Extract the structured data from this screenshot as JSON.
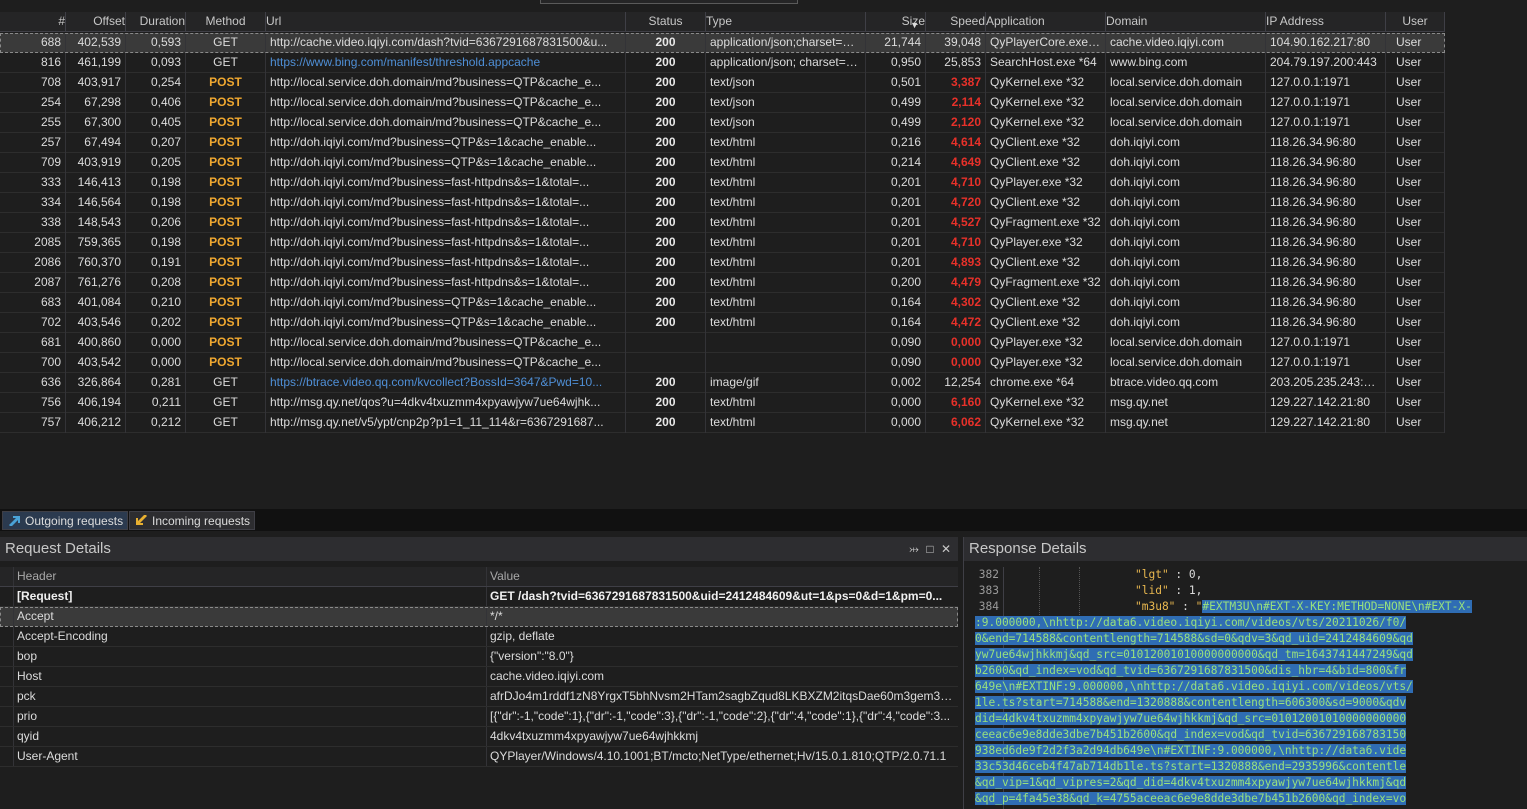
{
  "columns": [
    "#",
    "Offset",
    "Duration",
    "Method",
    "Url",
    "Status",
    "Type",
    "Size",
    "Speed",
    "Application",
    "Domain",
    "IP Address",
    "User"
  ],
  "sessions": [
    {
      "num": "688",
      "offset": "402,539",
      "duration": "0,593",
      "method": "GET",
      "url": "http://cache.video.iqiyi.com/dash?tvid=6367291687831500&u...",
      "status": "200",
      "type": "application/json;charset=ut...",
      "size": "21,744",
      "speed": "39,048",
      "app": "QyPlayerCore.exe *32",
      "domain": "cache.video.iqiyi.com",
      "ip": "104.90.162.217:80",
      "user": "User"
    },
    {
      "num": "816",
      "offset": "461,199",
      "duration": "0,093",
      "method": "GET",
      "url": "https://www.bing.com/manifest/threshold.appcache",
      "status": "200",
      "type": "application/json; charset=u...",
      "size": "0,950",
      "speed": "25,853",
      "app": "SearchHost.exe *64",
      "domain": "www.bing.com",
      "ip": "204.79.197.200:443",
      "user": "User"
    },
    {
      "num": "708",
      "offset": "403,917",
      "duration": "0,254",
      "method": "POST",
      "url": "http://local.service.doh.domain/md?business=QTP&cache_e...",
      "status": "200",
      "type": "text/json",
      "size": "0,501",
      "speed": "3,387",
      "app": "QyKernel.exe *32",
      "domain": "local.service.doh.domain",
      "ip": "127.0.0.1:1971",
      "user": "User"
    },
    {
      "num": "254",
      "offset": "67,298",
      "duration": "0,406",
      "method": "POST",
      "url": "http://local.service.doh.domain/md?business=QTP&cache_e...",
      "status": "200",
      "type": "text/json",
      "size": "0,499",
      "speed": "2,114",
      "app": "QyKernel.exe *32",
      "domain": "local.service.doh.domain",
      "ip": "127.0.0.1:1971",
      "user": "User"
    },
    {
      "num": "255",
      "offset": "67,300",
      "duration": "0,405",
      "method": "POST",
      "url": "http://local.service.doh.domain/md?business=QTP&cache_e...",
      "status": "200",
      "type": "text/json",
      "size": "0,499",
      "speed": "2,120",
      "app": "QyKernel.exe *32",
      "domain": "local.service.doh.domain",
      "ip": "127.0.0.1:1971",
      "user": "User"
    },
    {
      "num": "257",
      "offset": "67,494",
      "duration": "0,207",
      "method": "POST",
      "url": "http://doh.iqiyi.com/md?business=QTP&s=1&cache_enable...",
      "status": "200",
      "type": "text/html",
      "size": "0,216",
      "speed": "4,614",
      "app": "QyClient.exe *32",
      "domain": "doh.iqiyi.com",
      "ip": "118.26.34.96:80",
      "user": "User"
    },
    {
      "num": "709",
      "offset": "403,919",
      "duration": "0,205",
      "method": "POST",
      "url": "http://doh.iqiyi.com/md?business=QTP&s=1&cache_enable...",
      "status": "200",
      "type": "text/html",
      "size": "0,214",
      "speed": "4,649",
      "app": "QyClient.exe *32",
      "domain": "doh.iqiyi.com",
      "ip": "118.26.34.96:80",
      "user": "User"
    },
    {
      "num": "333",
      "offset": "146,413",
      "duration": "0,198",
      "method": "POST",
      "url": "http://doh.iqiyi.com/md?business=fast-httpdns&s=1&total=...",
      "status": "200",
      "type": "text/html",
      "size": "0,201",
      "speed": "4,710",
      "app": "QyPlayer.exe *32",
      "domain": "doh.iqiyi.com",
      "ip": "118.26.34.96:80",
      "user": "User"
    },
    {
      "num": "334",
      "offset": "146,564",
      "duration": "0,198",
      "method": "POST",
      "url": "http://doh.iqiyi.com/md?business=fast-httpdns&s=1&total=...",
      "status": "200",
      "type": "text/html",
      "size": "0,201",
      "speed": "4,720",
      "app": "QyClient.exe *32",
      "domain": "doh.iqiyi.com",
      "ip": "118.26.34.96:80",
      "user": "User"
    },
    {
      "num": "338",
      "offset": "148,543",
      "duration": "0,206",
      "method": "POST",
      "url": "http://doh.iqiyi.com/md?business=fast-httpdns&s=1&total=...",
      "status": "200",
      "type": "text/html",
      "size": "0,201",
      "speed": "4,527",
      "app": "QyFragment.exe *32",
      "domain": "doh.iqiyi.com",
      "ip": "118.26.34.96:80",
      "user": "User"
    },
    {
      "num": "2085",
      "offset": "759,365",
      "duration": "0,198",
      "method": "POST",
      "url": "http://doh.iqiyi.com/md?business=fast-httpdns&s=1&total=...",
      "status": "200",
      "type": "text/html",
      "size": "0,201",
      "speed": "4,710",
      "app": "QyPlayer.exe *32",
      "domain": "doh.iqiyi.com",
      "ip": "118.26.34.96:80",
      "user": "User"
    },
    {
      "num": "2086",
      "offset": "760,370",
      "duration": "0,191",
      "method": "POST",
      "url": "http://doh.iqiyi.com/md?business=fast-httpdns&s=1&total=...",
      "status": "200",
      "type": "text/html",
      "size": "0,201",
      "speed": "4,893",
      "app": "QyClient.exe *32",
      "domain": "doh.iqiyi.com",
      "ip": "118.26.34.96:80",
      "user": "User"
    },
    {
      "num": "2087",
      "offset": "761,276",
      "duration": "0,208",
      "method": "POST",
      "url": "http://doh.iqiyi.com/md?business=fast-httpdns&s=1&total=...",
      "status": "200",
      "type": "text/html",
      "size": "0,200",
      "speed": "4,479",
      "app": "QyFragment.exe *32",
      "domain": "doh.iqiyi.com",
      "ip": "118.26.34.96:80",
      "user": "User"
    },
    {
      "num": "683",
      "offset": "401,084",
      "duration": "0,210",
      "method": "POST",
      "url": "http://doh.iqiyi.com/md?business=QTP&s=1&cache_enable...",
      "status": "200",
      "type": "text/html",
      "size": "0,164",
      "speed": "4,302",
      "app": "QyClient.exe *32",
      "domain": "doh.iqiyi.com",
      "ip": "118.26.34.96:80",
      "user": "User"
    },
    {
      "num": "702",
      "offset": "403,546",
      "duration": "0,202",
      "method": "POST",
      "url": "http://doh.iqiyi.com/md?business=QTP&s=1&cache_enable...",
      "status": "200",
      "type": "text/html",
      "size": "0,164",
      "speed": "4,472",
      "app": "QyClient.exe *32",
      "domain": "doh.iqiyi.com",
      "ip": "118.26.34.96:80",
      "user": "User"
    },
    {
      "num": "681",
      "offset": "400,860",
      "duration": "0,000",
      "method": "POST",
      "url": "http://local.service.doh.domain/md?business=QTP&cache_e...",
      "status": "",
      "type": "",
      "size": "0,090",
      "speed": "0,000",
      "app": "QyPlayer.exe *32",
      "domain": "local.service.doh.domain",
      "ip": "127.0.0.1:1971",
      "user": "User"
    },
    {
      "num": "700",
      "offset": "403,542",
      "duration": "0,000",
      "method": "POST",
      "url": "http://local.service.doh.domain/md?business=QTP&cache_e...",
      "status": "",
      "type": "",
      "size": "0,090",
      "speed": "0,000",
      "app": "QyPlayer.exe *32",
      "domain": "local.service.doh.domain",
      "ip": "127.0.0.1:1971",
      "user": "User"
    },
    {
      "num": "636",
      "offset": "326,864",
      "duration": "0,281",
      "method": "GET",
      "url": "https://btrace.video.qq.com/kvcollect?BossId=3647&Pwd=10...",
      "status": "200",
      "type": "image/gif",
      "size": "0,002",
      "speed": "12,254",
      "app": "chrome.exe *64",
      "domain": "btrace.video.qq.com",
      "ip": "203.205.235.243:443",
      "user": "User"
    },
    {
      "num": "756",
      "offset": "406,194",
      "duration": "0,211",
      "method": "GET",
      "url": "http://msg.qy.net/qos?u=4dkv4txuzmm4xpyawjyw7ue64wjhk...",
      "status": "200",
      "type": "text/html",
      "size": "0,000",
      "speed": "6,160",
      "app": "QyKernel.exe *32",
      "domain": "msg.qy.net",
      "ip": "129.227.142.21:80",
      "user": "User"
    },
    {
      "num": "757",
      "offset": "406,212",
      "duration": "0,212",
      "method": "GET",
      "url": "http://msg.qy.net/v5/ypt/cnp2p?p1=1_11_114&r=6367291687...",
      "status": "200",
      "type": "text/html",
      "size": "0,000",
      "speed": "6,062",
      "app": "QyKernel.exe *32",
      "domain": "msg.qy.net",
      "ip": "129.227.142.21:80",
      "user": "User"
    }
  ],
  "tabs": {
    "outgoing": "Outgoing requests",
    "incoming": "Incoming requests"
  },
  "request_details": {
    "title": "Request Details",
    "col_header": "Header",
    "col_value": "Value",
    "rows": [
      {
        "h": "[Request]",
        "v": "GET /dash?tvid=6367291687831500&uid=2412484609&ut=1&ps=0&d=1&pm=0..."
      },
      {
        "h": "Accept",
        "v": "*/*"
      },
      {
        "h": "Accept-Encoding",
        "v": "gzip, deflate"
      },
      {
        "h": "bop",
        "v": "{\"version\":\"8.0\"}"
      },
      {
        "h": "Host",
        "v": "cache.video.iqiyi.com"
      },
      {
        "h": "pck",
        "v": "afrDJo4m1rddf1zN8YrgxT5bhNvsm2HTam2sagbZqud8LKBXZM2itqsDae60m3gem3BSt..."
      },
      {
        "h": "prio",
        "v": "[{\"dr\":-1,\"code\":1},{\"dr\":-1,\"code\":3},{\"dr\":-1,\"code\":2},{\"dr\":4,\"code\":1},{\"dr\":4,\"code\":3..."
      },
      {
        "h": "qyid",
        "v": "4dkv4txuzmm4xpyawjyw7ue64wjhkkmj"
      },
      {
        "h": "User-Agent",
        "v": "QYPlayer/Windows/4.10.1001;BT/mcto;NetType/ethernet;Hv/15.0.1.810;QTP/2.0.71.1"
      }
    ]
  },
  "response_details": {
    "title": "Response Details",
    "line_numbers": [
      "382",
      "383",
      "384"
    ],
    "line382": {
      "key": "\"lgt\"",
      "sep": " : ",
      "val": "0,"
    },
    "line383": {
      "key": "\"lid\"",
      "sep": " : ",
      "val": "1,"
    },
    "line384": {
      "key": "\"m3u8\"",
      "sep": " : ",
      "q": "\"",
      "val": "#EXTM3U\\n#EXT-X-KEY:METHOD=NONE\\n#EXT-X-"
    },
    "wrapped": [
      ":9.000000,\\nhttp://data6.video.iqiyi.com/videos/vts/20211026/f0/",
      "0&end=714588&contentlength=714588&sd=0&qdv=3&qd_uid=2412484609&qd",
      "yw7ue64wjhkkmj&qd_src=01012001010000000000&qd_tm=1643741447249&qd",
      "b2600&qd_index=vod&qd_tvid=6367291687831500&dis_hbr=4&bid=800&fr",
      "649e\\n#EXTINF:9.000000,\\nhttp://data6.video.iqiyi.com/videos/vts/",
      "1le.ts?start=714588&end=1320888&contentlength=606300&sd=9000&qdv",
      "did=4dkv4txuzmm4xpyawjyw7ue64wjhkkmj&qd_src=01012001010000000000",
      "ceeac6e9e8dde3dbe7b451b2600&qd_index=vod&qd_tvid=636729168783150",
      "938ed6de9f2d2f3a2d94db649e\\n#EXTINF:9.000000,\\nhttp://data6.vide",
      "33c53d46ceb4f47ab714db1le.ts?start=1320888&end=2935996&contentle",
      "&qd_vip=1&qd_vipres=2&qd_did=4dkv4txuzmm4xpyawjyw7ue64wjhkkmj&qd",
      "&qd_p=4fa45e38&qd_k=4755aceeac6e9e8dde3dbe7b451b2600&qd_index=vo"
    ]
  },
  "colors": {
    "post": "#f0a830",
    "https": "#4f8fd6",
    "slow_speed": "#e8312a",
    "selection": "#2f6db4"
  }
}
